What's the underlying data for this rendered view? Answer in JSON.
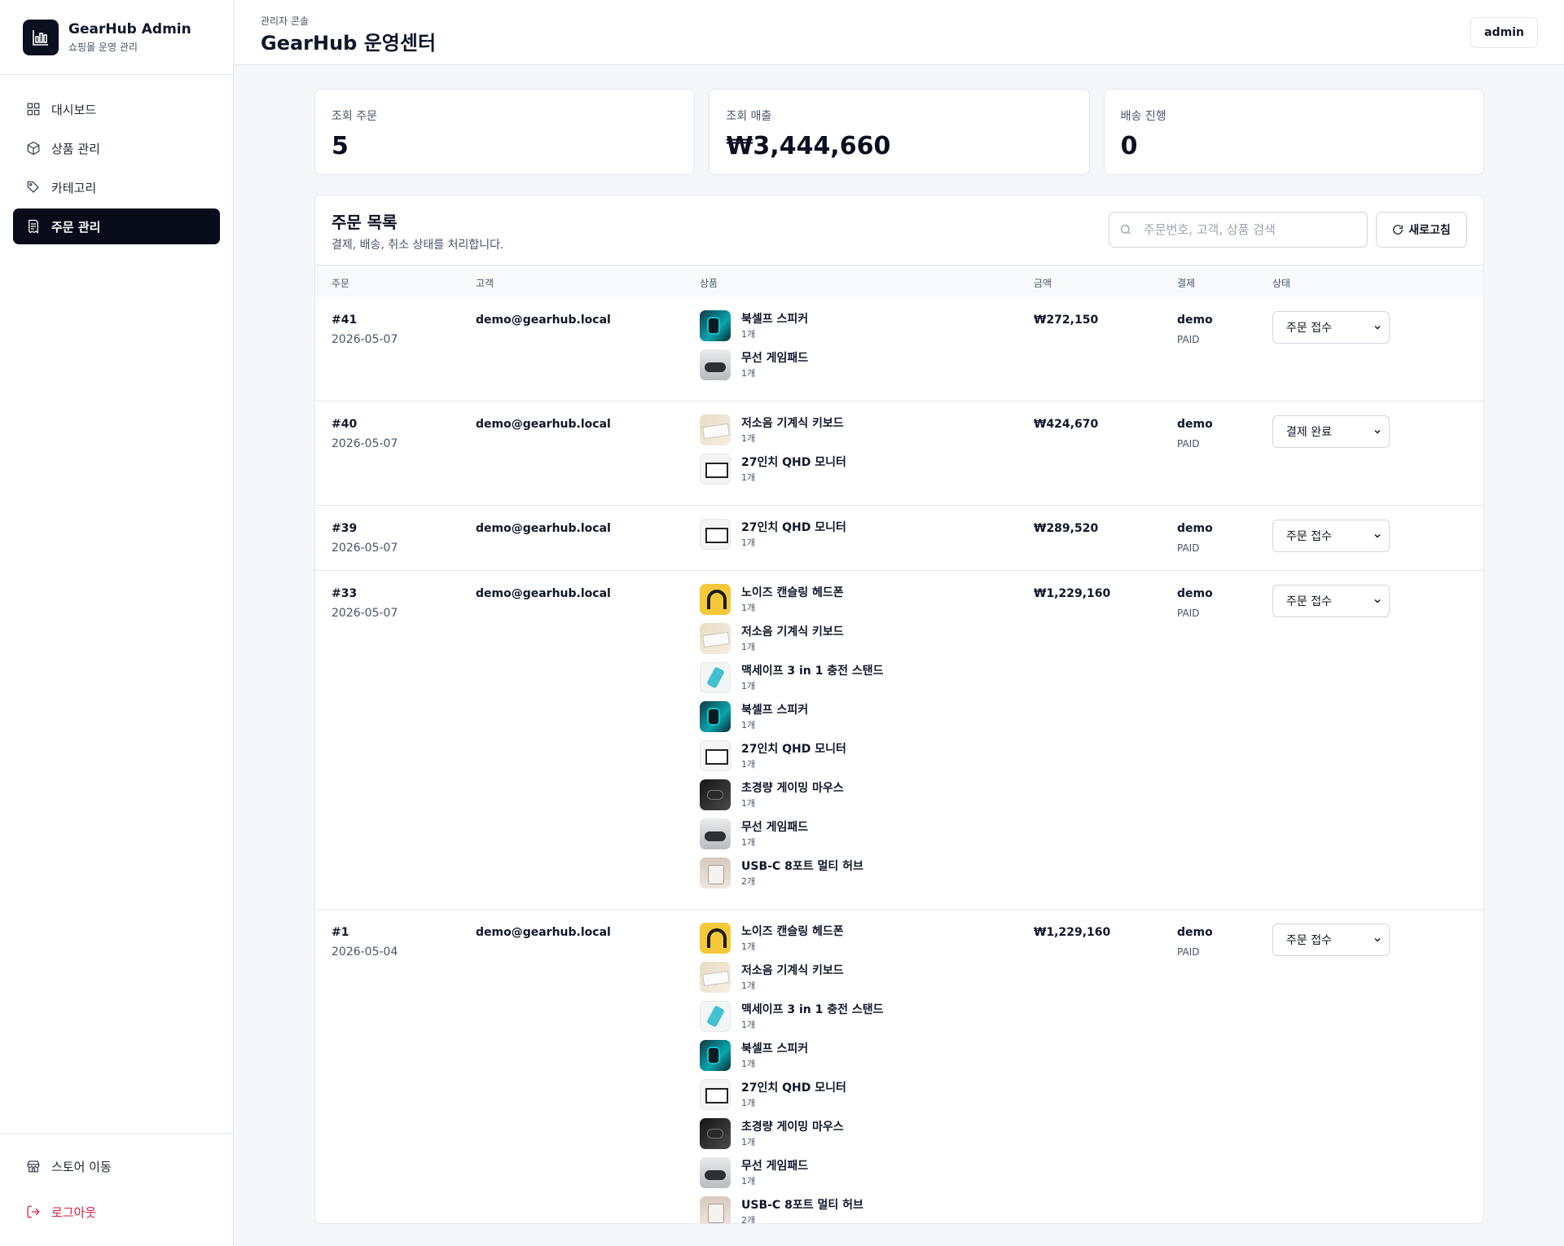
{
  "brand": {
    "title": "GearHub Admin",
    "subtitle": "쇼핑몰 운영 관리"
  },
  "nav": {
    "items": [
      {
        "label": "대시보드",
        "icon": "grid-icon"
      },
      {
        "label": "상품 관리",
        "icon": "box-icon"
      },
      {
        "label": "카테고리",
        "icon": "tag-icon"
      },
      {
        "label": "주문 관리",
        "icon": "receipt-icon",
        "active": true
      }
    ],
    "bottom": [
      {
        "label": "스토어 이동",
        "icon": "store-icon"
      },
      {
        "label": "로그아웃",
        "icon": "logout-icon"
      }
    ]
  },
  "header": {
    "breadcrumb": "관리자 콘솔",
    "title": "GearHub 운영센터",
    "user": "admin"
  },
  "stats": [
    {
      "label": "조회 주문",
      "value": "5"
    },
    {
      "label": "조회 매출",
      "value": "₩3,444,660"
    },
    {
      "label": "배송 진행",
      "value": "0"
    }
  ],
  "orders_panel": {
    "title": "주문 목록",
    "subtitle": "결제, 배송, 취소 상태를 처리합니다.",
    "search_placeholder": "주문번호, 고객, 상품 검색",
    "refresh_label": "새로고침",
    "columns": {
      "order": "주문",
      "customer": "고객",
      "items": "상품",
      "amount": "금액",
      "payment": "결제",
      "status": "상태"
    },
    "orders": [
      {
        "id": "#41",
        "date": "2026-05-07",
        "customer": "demo@gearhub.local",
        "amount": "₩272,150",
        "payment": "demo",
        "payment_status": "PAID",
        "status": "주문 접수",
        "items": [
          {
            "name": "북셀프 스피커",
            "qty": "1개",
            "thumb": "speaker"
          },
          {
            "name": "무선 게임패드",
            "qty": "1개",
            "thumb": "pad"
          }
        ]
      },
      {
        "id": "#40",
        "date": "2026-05-07",
        "customer": "demo@gearhub.local",
        "amount": "₩424,670",
        "payment": "demo",
        "payment_status": "PAID",
        "status": "결제 완료",
        "items": [
          {
            "name": "저소음 기계식 키보드",
            "qty": "1개",
            "thumb": "kbd"
          },
          {
            "name": "27인치 QHD 모니터",
            "qty": "1개",
            "thumb": "mon"
          }
        ]
      },
      {
        "id": "#39",
        "date": "2026-05-07",
        "customer": "demo@gearhub.local",
        "amount": "₩289,520",
        "payment": "demo",
        "payment_status": "PAID",
        "status": "주문 접수",
        "items": [
          {
            "name": "27인치 QHD 모니터",
            "qty": "1개",
            "thumb": "mon"
          }
        ]
      },
      {
        "id": "#33",
        "date": "2026-05-07",
        "customer": "demo@gearhub.local",
        "amount": "₩1,229,160",
        "payment": "demo",
        "payment_status": "PAID",
        "status": "주문 접수",
        "items": [
          {
            "name": "노이즈 캔슬링 헤드폰",
            "qty": "1개",
            "thumb": "head"
          },
          {
            "name": "저소음 기계식 키보드",
            "qty": "1개",
            "thumb": "kbd"
          },
          {
            "name": "맥세이프 3 in 1 충전 스탠드",
            "qty": "1개",
            "thumb": "charge"
          },
          {
            "name": "북셀프 스피커",
            "qty": "1개",
            "thumb": "speaker"
          },
          {
            "name": "27인치 QHD 모니터",
            "qty": "1개",
            "thumb": "mon"
          },
          {
            "name": "초경량 게이밍 마우스",
            "qty": "1개",
            "thumb": "mouse"
          },
          {
            "name": "무선 게임패드",
            "qty": "1개",
            "thumb": "pad"
          },
          {
            "name": "USB-C 8포트 멀티 허브",
            "qty": "2개",
            "thumb": "hub"
          }
        ]
      },
      {
        "id": "#1",
        "date": "2026-05-04",
        "customer": "demo@gearhub.local",
        "amount": "₩1,229,160",
        "payment": "demo",
        "payment_status": "PAID",
        "status": "주문 접수",
        "items": [
          {
            "name": "노이즈 캔슬링 헤드폰",
            "qty": "1개",
            "thumb": "head"
          },
          {
            "name": "저소음 기계식 키보드",
            "qty": "1개",
            "thumb": "kbd"
          },
          {
            "name": "맥세이프 3 in 1 충전 스탠드",
            "qty": "1개",
            "thumb": "charge"
          },
          {
            "name": "북셀프 스피커",
            "qty": "1개",
            "thumb": "speaker"
          },
          {
            "name": "27인치 QHD 모니터",
            "qty": "1개",
            "thumb": "mon"
          },
          {
            "name": "초경량 게이밍 마우스",
            "qty": "1개",
            "thumb": "mouse"
          },
          {
            "name": "무선 게임패드",
            "qty": "1개",
            "thumb": "pad"
          },
          {
            "name": "USB-C 8포트 멀티 허브",
            "qty": "2개",
            "thumb": "hub"
          }
        ]
      }
    ]
  },
  "colors": {
    "accent": "#070b1a",
    "danger": "#e11d48",
    "background": "#f5f7fa"
  }
}
